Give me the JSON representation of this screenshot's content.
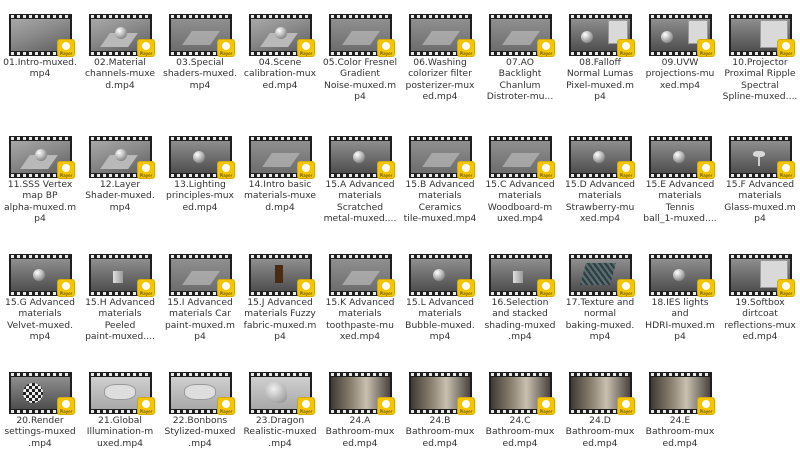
{
  "badge_text": "Player",
  "files": [
    {
      "name": "01.Intro-muxed.\nmp4",
      "thumb": "plain"
    },
    {
      "name": "02.Material\nchannels-muxe\nd.mp4",
      "thumb": "sphere-plane"
    },
    {
      "name": "03.Special\nshaders-muxed.\nmp4",
      "thumb": "plane"
    },
    {
      "name": "04.Scene\ncalibration-mux\ned.mp4",
      "thumb": "sphere-plane"
    },
    {
      "name": "05.Color Fresnel\nGradient\nNoise-muxed.m\np4",
      "thumb": "plane"
    },
    {
      "name": "06.Washing\ncolorizer filter\nposterizer-mux\ned.mp4",
      "thumb": "plane"
    },
    {
      "name": "07.AO\nBacklight\nChanlum\nDistroter-mu...",
      "thumb": "plane"
    },
    {
      "name": "08.Falloff\nNormal Lumas\nPixel-muxed.m\np4",
      "thumb": "sphere-panel"
    },
    {
      "name": "09.UVW\nprojections-mu\nxed.mp4",
      "thumb": "sphere-panel"
    },
    {
      "name": "10.Projector\nProximal Ripple\nSpectral\nSpline-muxed....",
      "thumb": "panel"
    },
    {
      "name": "11.SSS Vertex\nmap BP\nalpha-muxed.m\np4",
      "thumb": "sphere-plane"
    },
    {
      "name": "12.Layer\nShader-muxed.\nmp4",
      "thumb": "sphere-plane"
    },
    {
      "name": "13.Lighting\nprinciples-mux\ned.mp4",
      "thumb": "sphere"
    },
    {
      "name": "14.Intro basic\nmaterials-muxe\nd.mp4",
      "thumb": "plane"
    },
    {
      "name": "15.A Advanced\nmaterials\nScratched\nmetal-muxed....",
      "thumb": "sphere"
    },
    {
      "name": "15.B Advanced\nmaterials\nCeramics\ntile-muxed.mp4",
      "thumb": "plane"
    },
    {
      "name": "15.C Advanced\nmaterials\nWoodboard-m\nuxed.mp4",
      "thumb": "plane"
    },
    {
      "name": "15.D Advanced\nmaterials\nStrawberry-mu\nxed.mp4",
      "thumb": "sphere"
    },
    {
      "name": "15.E Advanced\nmaterials\nTennis\nball_1-muxed....",
      "thumb": "sphere"
    },
    {
      "name": "15.F Advanced\nmaterials\nGlass-muxed.m\np4",
      "thumb": "glass"
    },
    {
      "name": "15.G Advanced\nmaterials\nVelvet-muxed.\nmp4",
      "thumb": "sphere"
    },
    {
      "name": "15.H Advanced\nmaterials\nPeeled\npaint-muxed....",
      "thumb": "box"
    },
    {
      "name": "15.I Advanced\nmaterials Car\npaint-muxed.m\np4",
      "thumb": "plane"
    },
    {
      "name": "15.J Advanced\nmaterials Fuzzy\nfabric-muxed.m\np4",
      "thumb": "chair"
    },
    {
      "name": "15.K Advanced\nmaterials\ntoothpaste-mu\nxed.mp4",
      "thumb": "plane"
    },
    {
      "name": "15.L Advanced\nmaterials\nBubble-muxed.\nmp4",
      "thumb": "sphere"
    },
    {
      "name": "16.Selection\nand stacked\nshading-muxed\n.mp4",
      "thumb": "box"
    },
    {
      "name": "17.Texture and\nnormal\nbaking-muxed.\nmp4",
      "thumb": "texture"
    },
    {
      "name": "18.IES lights\nand\nHDRI-muxed.m\np4",
      "thumb": "sphere"
    },
    {
      "name": "19.Softbox\ndirtcoat\nreflections-mux\ned.mp4",
      "thumb": "panel"
    },
    {
      "name": "20.Render\nsettings-muxed\n.mp4",
      "thumb": "checker"
    },
    {
      "name": "21.Global\nIllumination-m\nuxed.mp4",
      "thumb": "light"
    },
    {
      "name": "22.Bonbons\nStylized-muxed\n.mp4",
      "thumb": "light"
    },
    {
      "name": "23.Dragon\nRealistic-muxed\n.mp4",
      "thumb": "dragon"
    },
    {
      "name": "24.A\nBathroom-mux\ned.mp4",
      "thumb": "room"
    },
    {
      "name": "24.B\nBathroom-mux\ned.mp4",
      "thumb": "room"
    },
    {
      "name": "24.C\nBathroom-mux\ned.mp4",
      "thumb": "room"
    },
    {
      "name": "24.D\nBathroom-mux\ned.mp4",
      "thumb": "room"
    },
    {
      "name": "24.E\nBathroom-mux\ned.mp4",
      "thumb": "room"
    }
  ]
}
